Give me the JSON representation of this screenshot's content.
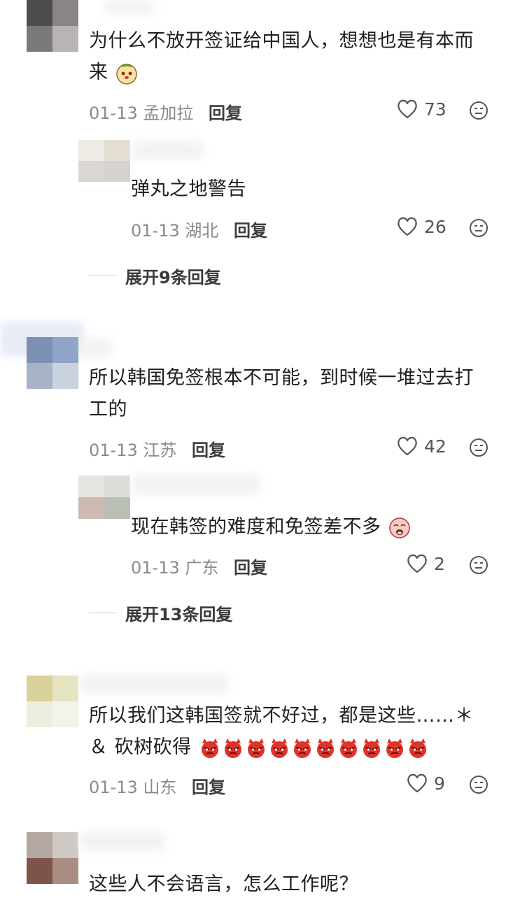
{
  "comments": [
    {
      "text_line1": "为什么不放开签证给中国人，想想也是有本而",
      "text_line2": "来",
      "date": "01-13",
      "location": "孟加拉",
      "reply_label": "回复",
      "likes": "73",
      "emoji": "dog-face-emoji",
      "reply": {
        "text": "弹丸之地警告",
        "date": "01-13",
        "location": "湖北",
        "reply_label": "回复",
        "likes": "26"
      },
      "expand_label": "展开9条回复"
    },
    {
      "text_line1": "所以韩国免签根本不可能，到时候一堆过去打",
      "text_line2": "工的",
      "date": "01-13",
      "location": "江苏",
      "reply_label": "回复",
      "likes": "42",
      "reply": {
        "text": "现在韩签的难度和免签差不多",
        "date": "01-13",
        "location": "广东",
        "reply_label": "回复",
        "likes": "2",
        "emoji": "crying-face-emoji"
      },
      "expand_label": "展开13条回复"
    },
    {
      "text_line1": "所以我们这韩国签就不好过，都是这些……＊",
      "text_line2": "＆ 砍树砍得",
      "date": "01-13",
      "location": "山东",
      "reply_label": "回复",
      "likes": "9",
      "emoji": "angry-devil-emoji"
    },
    {
      "text_line1": "这些人不会语言，怎么工作呢？"
    }
  ],
  "icons": {
    "like": "heart-outline-icon",
    "more": "neutral-face-icon"
  },
  "colors": {
    "text": "#1f1f1f",
    "meta": "#8a8a8a",
    "devil": "#e0332a"
  }
}
